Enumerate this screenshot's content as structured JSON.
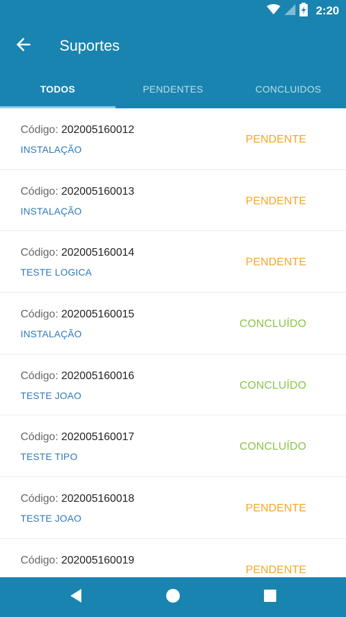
{
  "status_bar": {
    "time": "2:20",
    "icons": [
      "wifi-icon",
      "signal-icon",
      "battery-icon"
    ]
  },
  "app_bar": {
    "title": "Suportes",
    "back_icon": "arrow-left-icon"
  },
  "tabs": [
    {
      "label": "TODOS",
      "active": true
    },
    {
      "label": "PENDENTES",
      "active": false
    },
    {
      "label": "CONCLUIDOS",
      "active": false
    }
  ],
  "code_label": "Código:",
  "items": [
    {
      "code": "202005160012",
      "type": "INSTALAÇÃO",
      "status": "PENDENTE",
      "status_kind": "pendente"
    },
    {
      "code": "202005160013",
      "type": "INSTALAÇÃO",
      "status": "PENDENTE",
      "status_kind": "pendente"
    },
    {
      "code": "202005160014",
      "type": "TESTE LOGICA",
      "status": "PENDENTE",
      "status_kind": "pendente"
    },
    {
      "code": "202005160015",
      "type": "INSTALAÇÃO",
      "status": "CONCLUÍDO",
      "status_kind": "concluido"
    },
    {
      "code": "202005160016",
      "type": "TESTE JOAO",
      "status": "CONCLUÍDO",
      "status_kind": "concluido"
    },
    {
      "code": "202005160017",
      "type": "TESTE TIPO",
      "status": "CONCLUÍDO",
      "status_kind": "concluido"
    },
    {
      "code": "202005160018",
      "type": "TESTE JOAO",
      "status": "PENDENTE",
      "status_kind": "pendente"
    },
    {
      "code": "202005160019",
      "type": "",
      "status": "PENDENTE",
      "status_kind": "pendente"
    }
  ],
  "colors": {
    "primary": "#1a84b0",
    "pendente": "#f5a623",
    "concluido": "#8bc34a",
    "type_text": "#2d78b8"
  },
  "nav_bar": {
    "icons": [
      "nav-back-icon",
      "nav-home-icon",
      "nav-recents-icon"
    ]
  }
}
